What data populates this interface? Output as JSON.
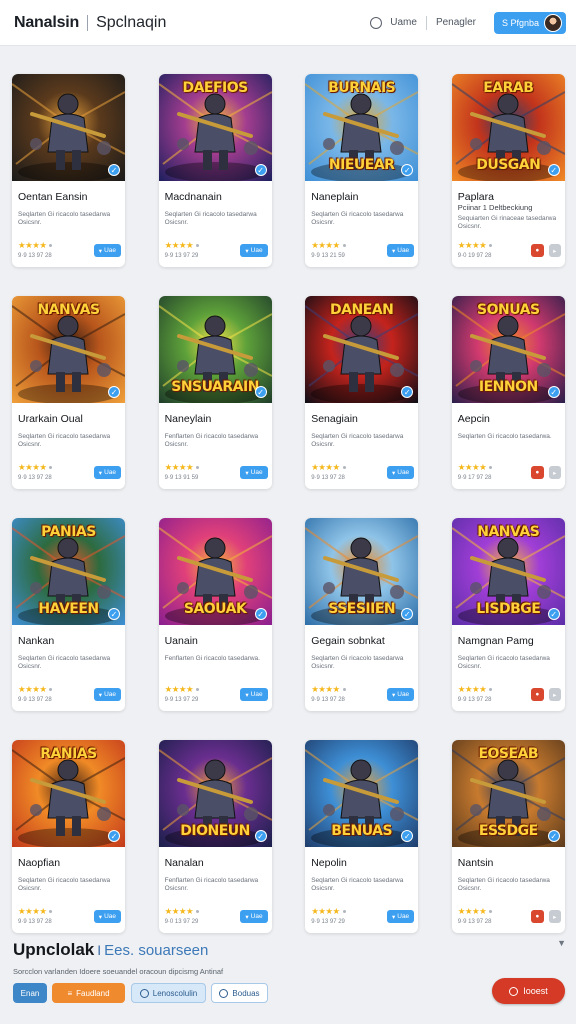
{
  "header": {
    "brand": "Nanalsin",
    "subtitle": "Spclnaqin",
    "nav_label": "Uame",
    "nav_link": "Penagler",
    "user_button": "S Pfgnba"
  },
  "cards": [
    {
      "title": "Oentan Eansin",
      "art_text": "",
      "desc": "Seqlarten Gi ricacolo tasedarwa Osicsnr.",
      "stars": "★★★★",
      "date": "9·9 13 97 28",
      "button": "Uae",
      "button_style": "blue",
      "colors": [
        "#1a1a1a",
        "#5b3a1c",
        "#e8a13c"
      ]
    },
    {
      "title": "Macdnanain",
      "art_text": "DAEFIOS",
      "art_pos": "top",
      "desc": "Seqlarten Gi ricacolo tasedarwa Osicsnr.",
      "stars": "★★★★",
      "date": "9·9 13 97 29",
      "button": "Uae",
      "button_style": "blue",
      "colors": [
        "#1c1f5e",
        "#a23d8f",
        "#f5b53a"
      ]
    },
    {
      "title": "Naneplain",
      "art_text": "NIEUEAR",
      "top_text": "BURNAIS",
      "desc": "Seqlarten Gi ricacolo tasedarwa Osicsnr.",
      "stars": "★★★★",
      "date": "9·9 13 21 59",
      "button": "Uae",
      "button_style": "blue",
      "colors": [
        "#3e8fd6",
        "#7ab7e8",
        "#e2a734"
      ]
    },
    {
      "title": "Paplara",
      "subtitle": "Pciinar 1 Deltbeckiung",
      "art_text": "DUSGAN",
      "top_text": "EARAB",
      "desc": "Sequiarten Gi rinaceae tasedarwa Osicsnr.",
      "stars": "★★★★",
      "date": "9·0 19 97 28",
      "button": "",
      "button_style": "red-gray",
      "colors": [
        "#f08a26",
        "#c2341c",
        "#2b3f6b"
      ]
    },
    {
      "title": "Urarkain Oual",
      "art_text": "",
      "top_text": "NANVAS",
      "desc": "Seqlarten Gi ricacolo tasedarwa Osicsnr.",
      "stars": "★★★★",
      "date": "9·9 13 97 28",
      "button": "Uae",
      "button_style": "blue",
      "colors": [
        "#f0a03a",
        "#b8561c",
        "#3a1f12"
      ]
    },
    {
      "title": "Naneylain",
      "art_text": "SNSUARAIN",
      "desc": "Fenflarten Gi ricacolo tasedarwa Osicsnr.",
      "stars": "★★★★",
      "date": "9·9 13 91 59",
      "button": "Uae",
      "button_style": "blue",
      "colors": [
        "#1f3d2a",
        "#5ea13a",
        "#f5e24a"
      ]
    },
    {
      "title": "Senagiain",
      "art_text": "",
      "top_text": "DANEAN",
      "desc": "Seqlarten Gi ricacolo tasedarwa Osicsnr.",
      "stars": "★★★★",
      "date": "9·9 13 97 28",
      "button": "Uae",
      "button_style": "blue",
      "colors": [
        "#0d0d15",
        "#c4231c",
        "#3b3f7a"
      ]
    },
    {
      "title": "Aepcin",
      "art_text": "IENNON",
      "top_text": "SONUAS",
      "desc": "Seqlarten Gi ricacolo tasedarwa.",
      "stars": "★★★★",
      "date": "9·9 17 97 28",
      "button": "",
      "button_style": "red-gray",
      "colors": [
        "#2a1e4a",
        "#d13a6e",
        "#f08a26"
      ]
    },
    {
      "title": "Nankan",
      "art_text": "HAVEEN",
      "top_text": "PANIAS",
      "desc": "Seqlarten Gi ricacolo tasedarwa Osicsnr.",
      "stars": "★★★★",
      "date": "9·9 13 97 28",
      "button": "Uae",
      "button_style": "blue",
      "colors": [
        "#3e8fd6",
        "#2d6b3f",
        "#e8562c"
      ]
    },
    {
      "title": "Uanain",
      "art_text": "SAOUAK",
      "desc": "Fenflarten Gi ricacolo tasedarwa.",
      "stars": "★★★★",
      "date": "9·9 13 97 29",
      "button": "Uae",
      "button_style": "blue",
      "colors": [
        "#8a1f8f",
        "#e0407a",
        "#f5b53a"
      ]
    },
    {
      "title": "Gegain sobnkat",
      "art_text": "SSESIIEN",
      "desc": "Seqlarten Gi ricacolo tasedarwa Osicsnr.",
      "stars": "★★★★",
      "date": "9·9 13 97 28",
      "button": "Uae",
      "button_style": "blue",
      "colors": [
        "#2d6ea8",
        "#8fc4e8",
        "#f08a26"
      ]
    },
    {
      "title": "Namgnan Pamg",
      "art_text": "LISDBGE",
      "top_text": "NANVAS",
      "desc": "Seqlarten Gi ricacolo tasedarwa Osicsnr.",
      "stars": "★★★★",
      "date": "9·9 13 97 28",
      "button": "",
      "button_style": "red-gray",
      "colors": [
        "#5b2ea8",
        "#a03ed6",
        "#f5b53a"
      ]
    },
    {
      "title": "Naopfian",
      "art_text": "",
      "top_text": "RANIAS",
      "desc": "Seqlarten Gi ricacolo tasedarwa Osicsnr.",
      "stars": "★★★★",
      "date": "9·9 13 97 28",
      "button": "Uae",
      "button_style": "blue",
      "colors": [
        "#c43a1c",
        "#f08a26",
        "#3a1f12"
      ]
    },
    {
      "title": "Nanalan",
      "art_text": "DIONEUN",
      "desc": "Fenflarten Gi ricacolo tasedarwa Osicsnr.",
      "stars": "★★★★",
      "date": "9·0 13 97 29",
      "button": "Uae",
      "button_style": "blue",
      "colors": [
        "#1a1f4a",
        "#6a2e8f",
        "#f0a03a"
      ]
    },
    {
      "title": "Nepolin",
      "art_text": "BENUAS",
      "desc": "Seqlarten Gi ricacolo tasedarwa Osicsnr.",
      "stars": "★★★★",
      "date": "9·9 13 97 29",
      "button": "Uae",
      "button_style": "blue",
      "colors": [
        "#1f3d6b",
        "#3e8fd6",
        "#e8a13c"
      ]
    },
    {
      "title": "Nantsin",
      "art_text": "ESSDGE",
      "top_text": "EOSEAB",
      "desc": "Seqlarten Gi ricacolo tasedarwa Osicsnr.",
      "stars": "★★★★",
      "date": "9·9 13 97 28",
      "button": "",
      "button_style": "red-gray",
      "colors": [
        "#5c3a1c",
        "#c77a2e",
        "#2b3a5e"
      ]
    }
  ],
  "footer": {
    "title": "Upnclolak",
    "separator": "I",
    "subtitle": "Ees. souarseen",
    "description": "Sorcclon varlanden Idoere soeuandel oracoun dipcismg Antinaf",
    "pills": [
      "Enan",
      "Faudland",
      "Lenoscolulin",
      "Boduas"
    ],
    "cta": "Iooest"
  }
}
